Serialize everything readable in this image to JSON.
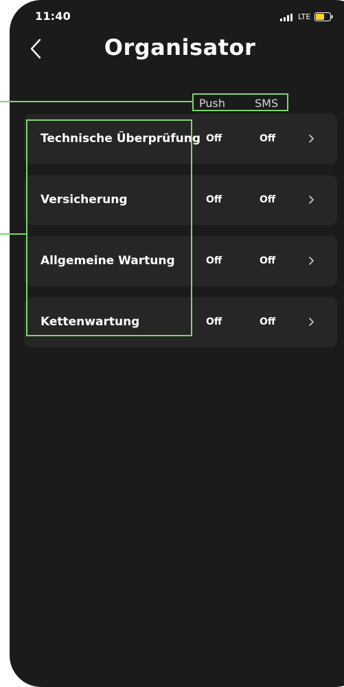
{
  "status_bar": {
    "time": "11:40",
    "network": "LTE",
    "signal_icon": "signal-bars-icon",
    "battery_icon": "battery-icon"
  },
  "nav": {
    "back_icon": "chevron-left-icon",
    "title": "Organisator"
  },
  "columns": {
    "push": "Push",
    "sms": "SMS"
  },
  "rows": [
    {
      "label": "Technische Überprüfung",
      "push": "Off",
      "sms": "Off"
    },
    {
      "label": "Versicherung",
      "push": "Off",
      "sms": "Off"
    },
    {
      "label": "Allgemeine Wartung",
      "push": "Off",
      "sms": "Off"
    },
    {
      "label": "Kettenwartung",
      "push": "Off",
      "sms": "Off"
    }
  ],
  "colors": {
    "background": "#1b1b1b",
    "row_background": "#262626",
    "text": "#ffffff",
    "annotation": "#7fd66e",
    "battery_fill": "#ffd21e"
  }
}
